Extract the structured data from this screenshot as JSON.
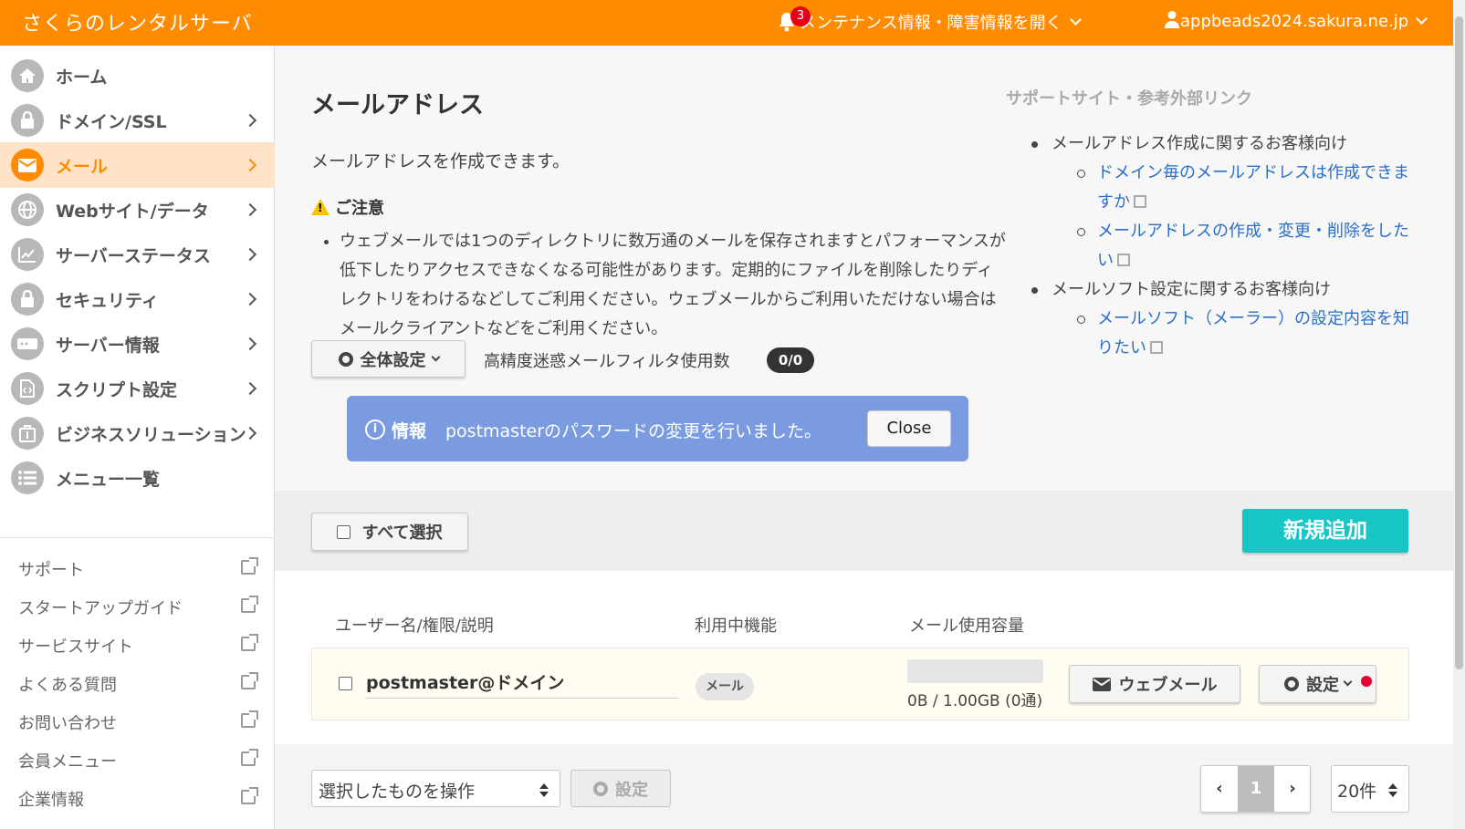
{
  "header": {
    "brand": "さくらのレンタルサーバ",
    "notification_count": "3",
    "maintenance_label": "メンテナンス情報・障害情報を開く",
    "account": "appbeads2024.sakura.ne.jp"
  },
  "sidebar": {
    "items": [
      {
        "label": "ホーム",
        "icon": "home-icon"
      },
      {
        "label": "ドメイン/SSL",
        "icon": "domain-lock-icon"
      },
      {
        "label": "メール",
        "icon": "mail-icon"
      },
      {
        "label": "Webサイト/データ",
        "icon": "globe-icon"
      },
      {
        "label": "サーバーステータス",
        "icon": "chart-icon"
      },
      {
        "label": "セキュリティ",
        "icon": "lock-icon"
      },
      {
        "label": "サーバー情報",
        "icon": "server-icon"
      },
      {
        "label": "スクリプト設定",
        "icon": "script-icon"
      },
      {
        "label": "ビジネスソリューション",
        "icon": "briefcase-icon"
      },
      {
        "label": "メニュー一覧",
        "icon": "list-icon"
      }
    ],
    "external": [
      "サポート",
      "スタートアップガイド",
      "サービスサイト",
      "よくある質問",
      "お問い合わせ",
      "会員メニュー",
      "企業情報"
    ]
  },
  "main": {
    "title": "メールアドレス",
    "description": "メールアドレスを作成できます。",
    "caution_title": "ご注意",
    "caution_text": "ウェブメールでは1つのディレクトリに数万通のメールを保存されますとパフォーマンスが低下したりアクセスできなくなる可能性があります。定期的にファイルを削除したりディレクトリをわけるなどしてご利用ください。ウェブメールからご利用いただけない場合はメールクライアントなどをご利用ください。",
    "global_settings": "全体設定",
    "filter_label": "高精度迷惑メールフィルタ使用数",
    "filter_count": "0/0",
    "info_label": "情報",
    "info_message": "postmasterのパスワードの変更を行いました。",
    "close_label": "Close",
    "select_all": "すべて選択",
    "new_button": "新規追加"
  },
  "support": {
    "title": "サポートサイト・参考外部リンク",
    "cat1": "メールアドレス作成に関するお客様向け",
    "link1": "ドメイン毎のメールアドレスは作成できますか",
    "link2": "メールアドレスの作成・変更・削除をしたい",
    "cat2": "メールソフト設定に関するお客様向け",
    "link3": "メールソフト（メーラー）の設定内容を知りたい"
  },
  "table": {
    "columns": [
      "ユーザー名/権限/説明",
      "利用中機能",
      "メール使用容量"
    ],
    "rows": [
      {
        "user": "postmaster@ドメイン",
        "feature": "メール",
        "usage": "0B / 1.00GB (0通)",
        "webmail": "ウェブメール",
        "settings": "設定"
      }
    ]
  },
  "footer": {
    "bulk_select": "選択したものを操作",
    "bulk_settings": "設定",
    "page": "1",
    "per_page": "20件"
  },
  "colors": {
    "brand": "#ff8c00",
    "info": "#7b9be0",
    "new_button": "#19c6c6"
  }
}
